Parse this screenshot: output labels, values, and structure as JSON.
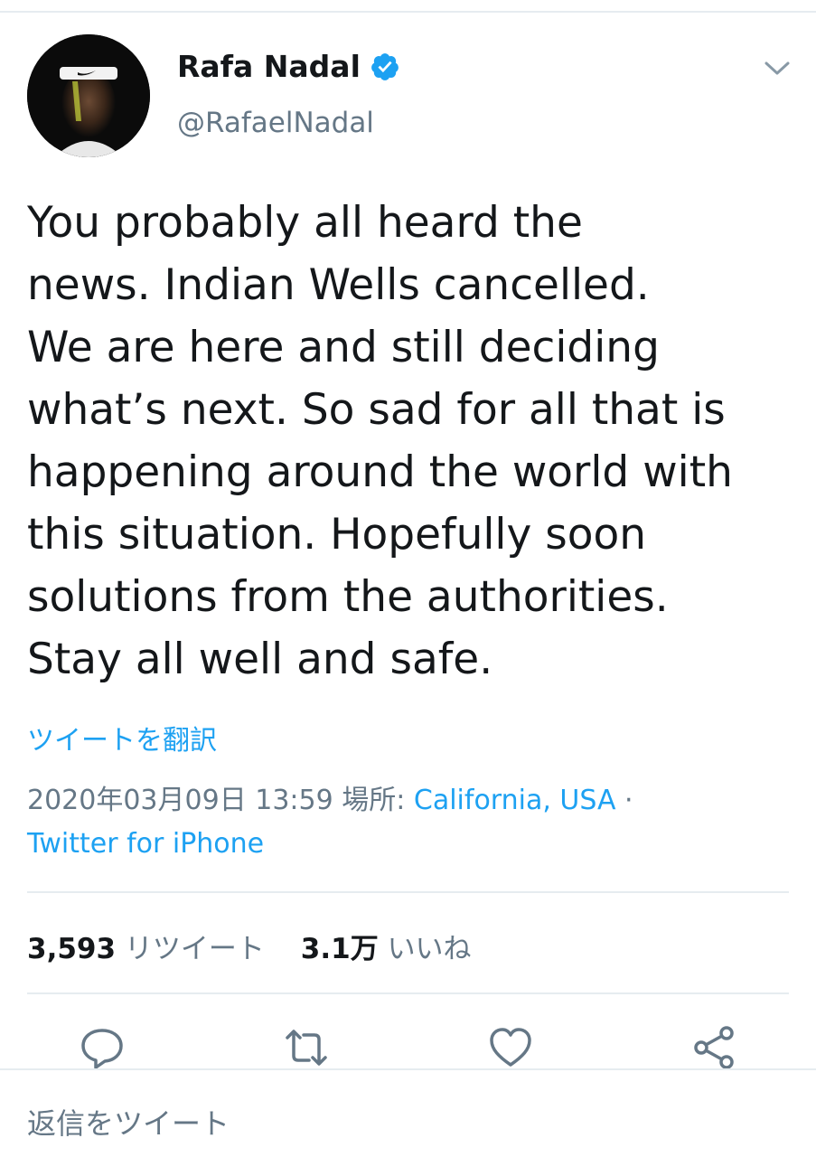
{
  "user": {
    "display_name": "Rafa Nadal",
    "handle": "@RafaelNadal",
    "verified": true
  },
  "tweet": {
    "lines": [
      "You probably all heard the",
      "news. Indian Wells cancelled.",
      "We are here and still deciding",
      "what’s next. So sad for all that is",
      "happening around the world with",
      "this situation. Hopefully soon",
      "solutions from the authorities.",
      "Stay all well and safe."
    ],
    "translate_label": "ツイートを翻訳",
    "timestamp": "2020年03月09日 13:59",
    "location_label": "場所:",
    "location": "California, USA",
    "separator": "·",
    "source": "Twitter for iPhone"
  },
  "stats": {
    "retweets_count": "3,593",
    "retweets_label": "リツイート",
    "likes_count": "3.1万",
    "likes_label": "いいね"
  },
  "reply": {
    "placeholder": "返信をツイート"
  },
  "colors": {
    "accent": "#1da1f2",
    "secondary_text": "#657786",
    "primary_text": "#14171a",
    "divider": "#e6ecf0"
  },
  "icons": {
    "verified": "verified-badge-icon",
    "caret": "chevron-down-icon",
    "reply": "reply-icon",
    "retweet": "retweet-icon",
    "like": "heart-icon",
    "share": "share-icon"
  }
}
